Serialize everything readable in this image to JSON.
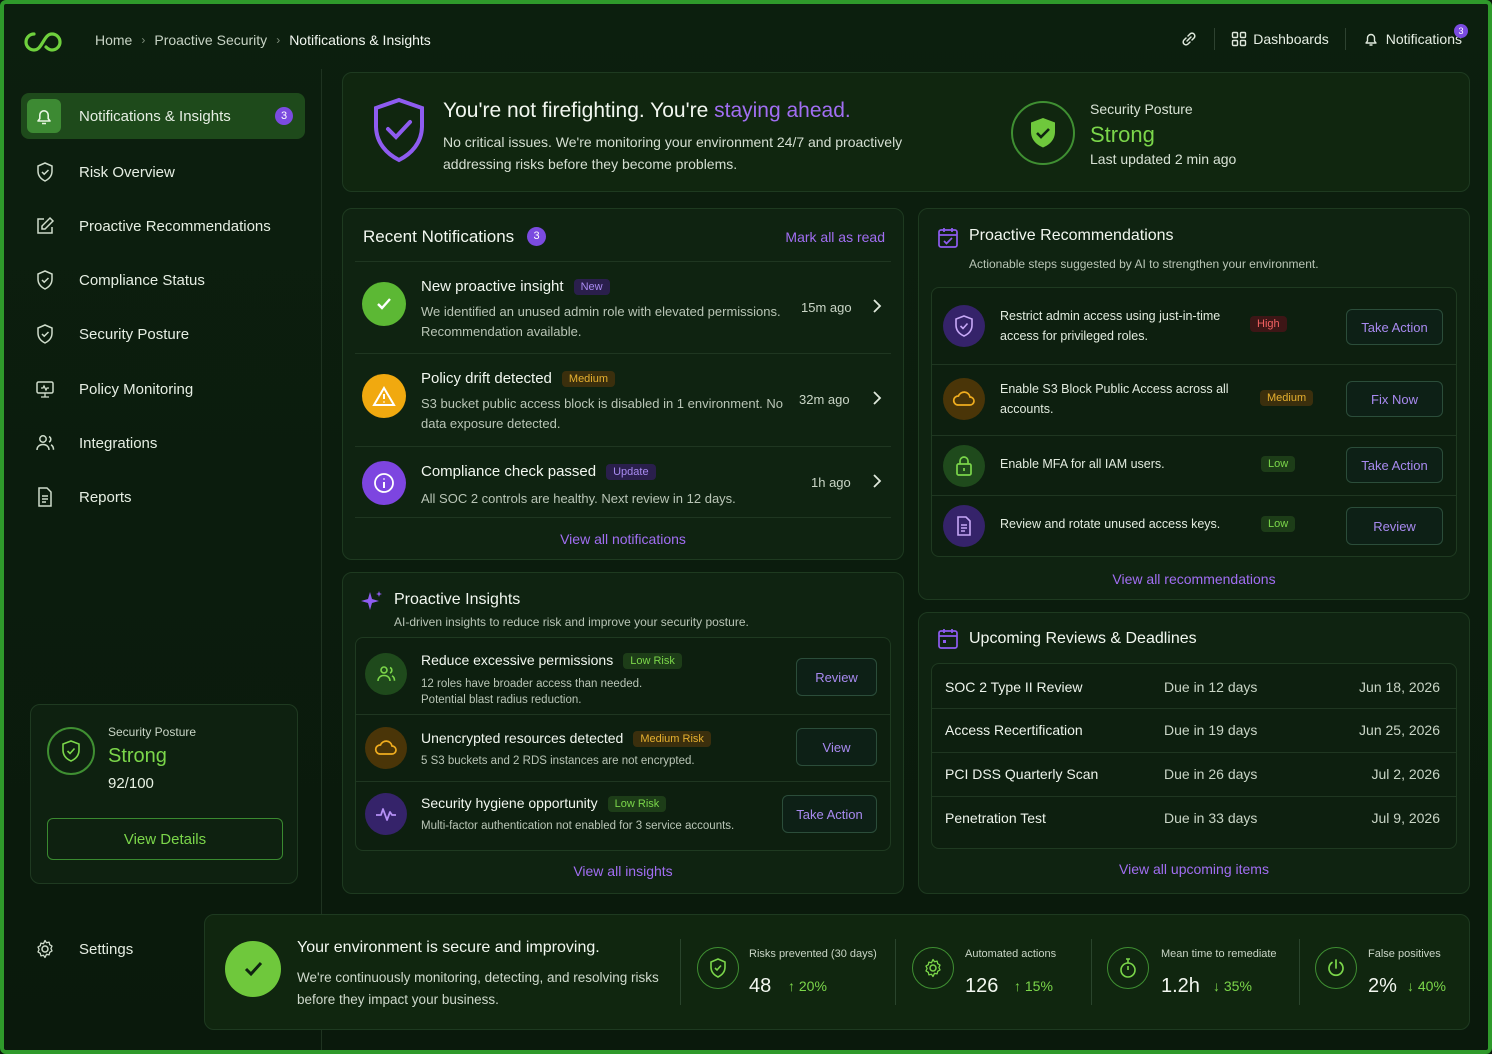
{
  "breadcrumb": {
    "home": "Home",
    "section": "Proactive Security",
    "current": "Notifications & Insights"
  },
  "topbar": {
    "dashboards": "Dashboards",
    "notifications": "Notifications",
    "notif_count": "3"
  },
  "sidebar": {
    "items": [
      {
        "label": "Notifications & Insights",
        "badge": "3",
        "icon": "bell-icon"
      },
      {
        "label": "Risk Overview",
        "icon": "shield-check-icon"
      },
      {
        "label": "Proactive Recommendations",
        "icon": "edit-icon"
      },
      {
        "label": "Compliance Status",
        "icon": "shield-check-icon"
      },
      {
        "label": "Security Posture",
        "icon": "shield-check-icon"
      },
      {
        "label": "Policy Monitoring",
        "icon": "monitor-icon"
      },
      {
        "label": "Integrations",
        "icon": "users-icon"
      },
      {
        "label": "Reports",
        "icon": "document-icon"
      }
    ],
    "posture": {
      "label": "Security Posture",
      "value": "Strong",
      "score": "92/100",
      "button": "View Details"
    },
    "settings": "Settings"
  },
  "hero": {
    "title_a": "You're not firefighting. You're ",
    "title_b": "staying ahead.",
    "desc": "No critical issues. We're monitoring your environment 24/7 and proactively addressing risks before they become problems.",
    "posture_label": "Security Posture",
    "posture_value": "Strong",
    "updated": "Last updated 2 min ago"
  },
  "notifications": {
    "title": "Recent Notifications",
    "count": "3",
    "mark_all": "Mark all as read",
    "footer": "View all notifications",
    "items": [
      {
        "title": "New proactive insight",
        "tag": "New",
        "desc": "We identified an unused admin role with elevated permissions. Recommendation available.",
        "time": "15m ago",
        "icon": "check-icon"
      },
      {
        "title": "Policy drift detected",
        "tag": "Medium",
        "desc": "S3 bucket public access block is disabled in 1 environment. No data exposure detected.",
        "time": "32m ago",
        "icon": "warning-icon"
      },
      {
        "title": "Compliance check passed",
        "tag": "Update",
        "desc": "All SOC 2 controls are healthy. Next review in 12 days.",
        "time": "1h ago",
        "icon": "info-icon"
      }
    ]
  },
  "insights": {
    "title": "Proactive Insights",
    "subtitle": "AI-driven insights to reduce risk and improve your security posture.",
    "footer": "View all insights",
    "items": [
      {
        "title": "Reduce excessive permissions",
        "tag": "Low Risk",
        "desc": "12 roles have broader access than needed. Potential blast radius reduction.",
        "button": "Review",
        "icon": "users-icon"
      },
      {
        "title": "Unencrypted resources detected",
        "tag": "Medium Risk",
        "desc": "5 S3 buckets and 2 RDS instances are not encrypted.",
        "button": "View",
        "icon": "cloud-icon"
      },
      {
        "title": "Security hygiene opportunity",
        "tag": "Low Risk",
        "desc": "Multi-factor authentication not enabled for 3 service accounts.",
        "button": "Take Action",
        "icon": "pulse-icon"
      }
    ]
  },
  "recommendations": {
    "title": "Proactive Recommendations",
    "subtitle": "Actionable steps suggested by AI to strengthen your environment.",
    "footer": "View all recommendations",
    "items": [
      {
        "text": "Restrict admin access using just-in-time access for privileged roles.",
        "priority": "High",
        "button": "Take Action",
        "icon": "shield-check-icon"
      },
      {
        "text": "Enable S3 Block Public Access across all accounts.",
        "priority": "Medium",
        "button": "Fix Now",
        "icon": "cloud-icon"
      },
      {
        "text": "Enable MFA for all IAM users.",
        "priority": "Low",
        "button": "Take Action",
        "icon": "lock-icon"
      },
      {
        "text": "Review and rotate unused access keys.",
        "priority": "Low",
        "button": "Review",
        "icon": "document-icon"
      }
    ]
  },
  "upcoming": {
    "title": "Upcoming Reviews & Deadlines",
    "footer": "View all upcoming items",
    "rows": [
      {
        "name": "SOC 2 Type II Review",
        "due": "Due in 12 days",
        "date": "Jun 18, 2026"
      },
      {
        "name": "Access Recertification",
        "due": "Due in 19 days",
        "date": "Jun 25, 2026"
      },
      {
        "name": "PCI DSS Quarterly Scan",
        "due": "Due in 26 days",
        "date": "Jul 2, 2026"
      },
      {
        "name": "Penetration Test",
        "due": "Due in 33 days",
        "date": "Jul 9, 2026"
      }
    ]
  },
  "summary": {
    "title": "Your environment is secure and improving.",
    "desc": "We're continuously monitoring, detecting, and resolving risks before they impact your business.",
    "stats": [
      {
        "label": "Risks prevented (30 days)",
        "value": "48",
        "change": "20%",
        "dir": "up",
        "icon": "shield-check-icon"
      },
      {
        "label": "Automated actions",
        "value": "126",
        "change": "15%",
        "dir": "up",
        "icon": "gear-icon"
      },
      {
        "label": "Mean time to remediate",
        "value": "1.2h",
        "change": "35%",
        "dir": "down",
        "icon": "stopwatch-icon"
      },
      {
        "label": "False positives",
        "value": "2%",
        "change": "40%",
        "dir": "down",
        "icon": "power-icon"
      }
    ]
  },
  "colors": {
    "accent_green": "#7bd64a",
    "accent_purple": "#a16ef2",
    "background": "#0b1a0d",
    "border_green": "#2f9a2b"
  }
}
